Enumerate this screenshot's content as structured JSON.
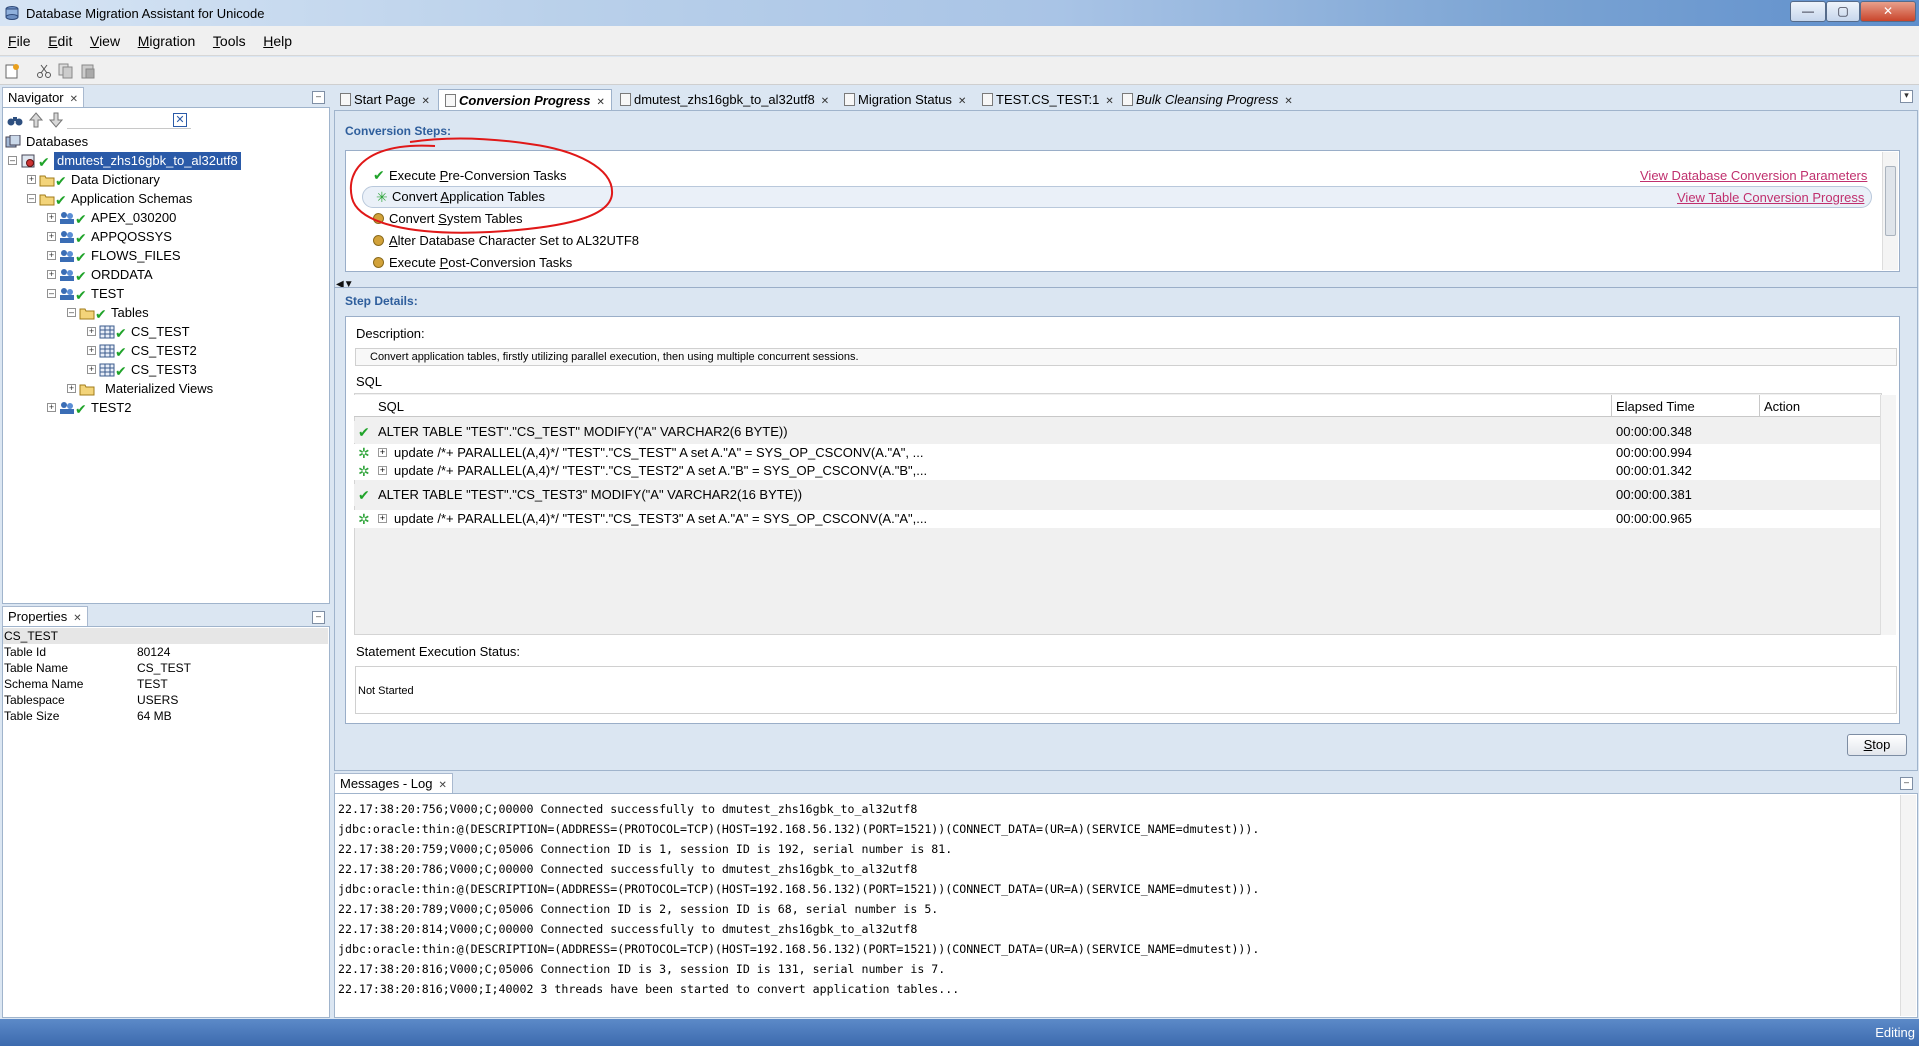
{
  "window": {
    "title": "Database Migration Assistant for Unicode",
    "min": "—",
    "max": "▢",
    "close": "✕"
  },
  "menu": {
    "file": {
      "u": "F",
      "rest": "ile"
    },
    "edit": {
      "u": "E",
      "rest": "dit"
    },
    "view": {
      "u": "V",
      "rest": "iew"
    },
    "migration": {
      "u": "M",
      "rest": "igration"
    },
    "tools": {
      "u": "T",
      "rest": "ools"
    },
    "help": {
      "u": "H",
      "rest": "elp"
    }
  },
  "navigator": {
    "tab_label": "Navigator",
    "tree": {
      "databases": "Databases",
      "connection": "dmutest_zhs16gbk_to_al32utf8",
      "data_dictionary": "Data Dictionary",
      "application_schemas": "Application Schemas",
      "schemas": [
        "APEX_030200",
        "APPQOSSYS",
        "FLOWS_FILES",
        "ORDDATA",
        "TEST"
      ],
      "tables": "Tables",
      "table_items": [
        "CS_TEST",
        "CS_TEST2",
        "CS_TEST3"
      ],
      "materialized_views": "Materialized Views",
      "test2": "TEST2"
    }
  },
  "properties": {
    "tab_label": "Properties",
    "object": "CS_TEST",
    "rows": [
      {
        "k": "Table Id",
        "v": "80124"
      },
      {
        "k": "Table Name",
        "v": "CS_TEST"
      },
      {
        "k": "Schema Name",
        "v": "TEST"
      },
      {
        "k": "Tablespace",
        "v": "USERS"
      },
      {
        "k": "Table Size",
        "v": "64 MB"
      }
    ]
  },
  "editor_tabs": [
    "Start Page",
    "Conversion Progress",
    "dmutest_zhs16gbk_to_al32utf8",
    "Migration Status",
    "TEST.CS_TEST:1",
    "Bulk Cleansing Progress"
  ],
  "conversion": {
    "steps_title": "Conversion Steps:",
    "steps": [
      {
        "pre": "Execute ",
        "u": "P",
        "post": "re-Conversion Tasks"
      },
      {
        "pre": "Convert ",
        "u": "A",
        "post": "pplication Tables"
      },
      {
        "pre": "Convert ",
        "u": "S",
        "post": "ystem Tables"
      },
      {
        "pre": "",
        "u": "A",
        "post": "lter Database Character Set to AL32UTF8"
      },
      {
        "pre": "Execute ",
        "u": "P",
        "post": "ost-Conversion Tasks"
      }
    ],
    "link_params": "View Database Conversion Parameters",
    "link_progress": "View Table Conversion Progress",
    "details_title": "Step Details:",
    "description_label": "Description:",
    "description": "Convert application tables, firstly utilizing parallel execution, then using multiple concurrent sessions.",
    "sql_label": "SQL",
    "col_sql": "SQL",
    "col_elapsed": "Elapsed Time",
    "col_action": "Action",
    "sql_rows": [
      {
        "type": "check",
        "text": "ALTER TABLE \"TEST\".\"CS_TEST\" MODIFY(\"A\" VARCHAR2(6 BYTE))",
        "time": "00:00:00.348"
      },
      {
        "type": "gear",
        "text": "update /*+ PARALLEL(A,4)*/ \"TEST\".\"CS_TEST\"  A  set A.\"A\" = SYS_OP_CSCONV(A.\"A\", ...",
        "time": "00:00:00.994"
      },
      {
        "type": "gear",
        "text": "update /*+ PARALLEL(A,4)*/ \"TEST\".\"CS_TEST2\"  A  set A.\"B\" = SYS_OP_CSCONV(A.\"B\",...",
        "time": "00:00:01.342"
      },
      {
        "type": "check",
        "text": "ALTER TABLE \"TEST\".\"CS_TEST3\" MODIFY(\"A\" VARCHAR2(16 BYTE))",
        "time": "00:00:00.381"
      },
      {
        "type": "gear",
        "text": "update /*+ PARALLEL(A,4)*/ \"TEST\".\"CS_TEST3\"  A  set A.\"A\" = SYS_OP_CSCONV(A.\"A\",...",
        "time": "00:00:00.965"
      }
    ],
    "exec_status_label": "Statement Execution Status:",
    "exec_status": "Not Started",
    "stop": {
      "u": "S",
      "rest": "top"
    }
  },
  "messages": {
    "tab_label": "Messages - Log",
    "lines": [
      "22.17:38:20:756;V000;C;00000 Connected successfully to dmutest_zhs16gbk_to_al32utf8",
      "jdbc:oracle:thin:@(DESCRIPTION=(ADDRESS=(PROTOCOL=TCP)(HOST=192.168.56.132)(PORT=1521))(CONNECT_DATA=(UR=A)(SERVICE_NAME=dmutest))).",
      "22.17:38:20:759;V000;C;05006 Connection ID is 1, session ID is 192, serial number is 81.",
      "22.17:38:20:786;V000;C;00000 Connected successfully to dmutest_zhs16gbk_to_al32utf8",
      "jdbc:oracle:thin:@(DESCRIPTION=(ADDRESS=(PROTOCOL=TCP)(HOST=192.168.56.132)(PORT=1521))(CONNECT_DATA=(UR=A)(SERVICE_NAME=dmutest))).",
      "22.17:38:20:789;V000;C;05006 Connection ID is 2, session ID is 68, serial number is 5.",
      "22.17:38:20:814;V000;C;00000 Connected successfully to dmutest_zhs16gbk_to_al32utf8",
      "jdbc:oracle:thin:@(DESCRIPTION=(ADDRESS=(PROTOCOL=TCP)(HOST=192.168.56.132)(PORT=1521))(CONNECT_DATA=(UR=A)(SERVICE_NAME=dmutest))).",
      "22.17:38:20:816;V000;C;05006 Connection ID is 3, session ID is 131, serial number is 7.",
      "22.17:38:20:816;V000;I;40002 3 threads have been started to convert application tables..."
    ]
  },
  "status": {
    "text": "Editing"
  },
  "colors": {
    "accent": "#2a5aa8",
    "link": "#c0306e",
    "section": "#2e5e9c",
    "annotation": "#e01818",
    "ok": "#20a32a"
  },
  "icons": [
    "app-icon",
    "binoculars-icon",
    "up-arrow-icon",
    "down-arrow-icon",
    "clear-icon",
    "folder-icon",
    "schema-icon",
    "table-icon",
    "check-icon",
    "gear-icon",
    "pending-icon",
    "new-icon",
    "cut-icon",
    "copy-icon",
    "paste-icon"
  ]
}
